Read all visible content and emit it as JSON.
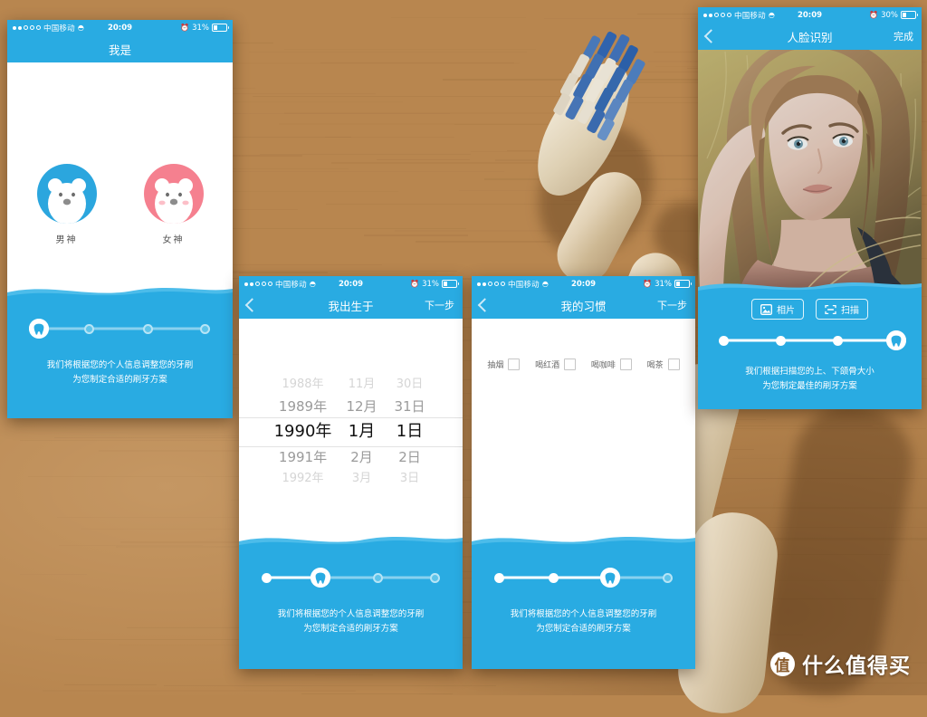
{
  "background": {
    "surface": "wooden-desk",
    "object": "toothbrush",
    "wood_color": "#c79058"
  },
  "watermark": {
    "logo_char": "值",
    "text": "什么值得买"
  },
  "theme": {
    "accent": "#29abe2",
    "accent_light": "#5ec4ea",
    "male": "#2ba6de",
    "female": "#f5808f"
  },
  "phones": [
    {
      "id": "phone-gender",
      "status": {
        "carrier": "中国移动",
        "wifi_icon": "wifi-icon",
        "time": "20:09",
        "alarm_icon": "alarm-icon",
        "battery": "31%",
        "signal_filled": 2,
        "signal_total": 5
      },
      "nav": {
        "title": "我是",
        "back": "",
        "right": ""
      },
      "options": [
        {
          "label": "男神",
          "icon": "bear-icon",
          "color": "#2ba6de"
        },
        {
          "label": "女神",
          "icon": "bear-icon",
          "color": "#f5808f"
        }
      ],
      "stepper": {
        "current": 1,
        "total": 4,
        "icon": "tooth-icon"
      },
      "tip": {
        "line1": "我们将根据您的个人信息调整您的牙刷",
        "line2": "为您制定合适的刷牙方案"
      }
    },
    {
      "id": "phone-birthday",
      "status": {
        "carrier": "中国移动",
        "wifi_icon": "wifi-icon",
        "time": "20:09",
        "alarm_icon": "alarm-icon",
        "battery": "31%",
        "signal_filled": 2,
        "signal_total": 5
      },
      "nav": {
        "title": "我出生于",
        "back": "chevron-left-icon",
        "right": "下一步"
      },
      "picker": {
        "years": [
          "1988年",
          "1989年",
          "1990年",
          "1991年",
          "1992年"
        ],
        "months": [
          "11月",
          "12月",
          "1月",
          "2月",
          "3月"
        ],
        "days": [
          "30日",
          "31日",
          "1日",
          "2日",
          "3日"
        ],
        "selected_index": 2,
        "selected": {
          "year": "1990年",
          "month": "1月",
          "day": "1日"
        }
      },
      "stepper": {
        "current": 2,
        "total": 4,
        "icon": "tooth-icon"
      },
      "tip": {
        "line1": "我们将根据您的个人信息调整您的牙刷",
        "line2": "为您制定合适的刷牙方案"
      }
    },
    {
      "id": "phone-habits",
      "status": {
        "carrier": "中国移动",
        "wifi_icon": "wifi-icon",
        "time": "20:09",
        "alarm_icon": "alarm-icon",
        "battery": "31%",
        "signal_filled": 2,
        "signal_total": 5
      },
      "nav": {
        "title": "我的习惯",
        "back": "chevron-left-icon",
        "right": "下一步"
      },
      "habits": [
        {
          "label": "抽烟",
          "checked": false
        },
        {
          "label": "喝红酒",
          "checked": false
        },
        {
          "label": "喝咖啡",
          "checked": false
        },
        {
          "label": "喝茶",
          "checked": false
        }
      ],
      "stepper": {
        "current": 3,
        "total": 4,
        "icon": "tooth-icon"
      },
      "tip": {
        "line1": "我们将根据您的个人信息调整您的牙刷",
        "line2": "为您制定合适的刷牙方案"
      }
    },
    {
      "id": "phone-face",
      "status": {
        "carrier": "中国移动",
        "wifi_icon": "wifi-icon",
        "time": "20:09",
        "alarm_icon": "alarm-icon",
        "battery": "30%",
        "signal_filled": 2,
        "signal_total": 5
      },
      "nav": {
        "title": "人脸识别",
        "back": "chevron-left-icon",
        "right": "完成"
      },
      "photo": {
        "subject": "portrait-photo-woman"
      },
      "actions": [
        {
          "label": "相片",
          "icon": "image-icon"
        },
        {
          "label": "扫描",
          "icon": "scan-icon"
        }
      ],
      "stepper": {
        "current": 4,
        "total": 4,
        "icon": "tooth-icon"
      },
      "tip": {
        "line1": "我们根据扫描您的上、下颌骨大小",
        "line2": "为您制定最佳的刷牙方案"
      }
    }
  ]
}
